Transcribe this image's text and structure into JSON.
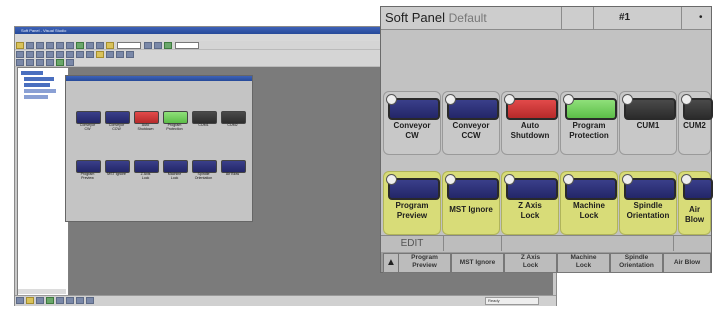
{
  "ide": {
    "title": "Soft Panel - Visual Studio",
    "menu": [
      "File",
      "Edit",
      "View",
      "Project",
      "Build",
      "Debug",
      "Tools",
      "Window",
      "Help"
    ],
    "status_text": "Ready"
  },
  "inner_panel": {
    "row1": [
      {
        "label": "Conveyor\nCW",
        "color": "blue"
      },
      {
        "label": "Conveyor\nCCW",
        "color": "blue"
      },
      {
        "label": "Auto\nShutdown",
        "color": "red"
      },
      {
        "label": "Program\nProtection",
        "color": "green"
      },
      {
        "label": "CUM1",
        "color": "dark"
      },
      {
        "label": "CUM2",
        "color": "dark"
      }
    ],
    "row2": [
      {
        "label": "Program\nPreview",
        "color": "blue"
      },
      {
        "label": "MST Ignore",
        "color": "blue"
      },
      {
        "label": "Z Axis\nLock",
        "color": "blue"
      },
      {
        "label": "Machine\nLock",
        "color": "blue"
      },
      {
        "label": "Spindle\nOrientation",
        "color": "blue"
      },
      {
        "label": "Air Blow",
        "color": "blue"
      }
    ]
  },
  "soft_panel": {
    "title": "Soft Panel",
    "subtitle": "Default",
    "number": "#1",
    "row1": [
      {
        "label": "Conveyor\nCW",
        "color": "blue"
      },
      {
        "label": "Conveyor\nCCW",
        "color": "blue"
      },
      {
        "label": "Auto\nShutdown",
        "color": "red"
      },
      {
        "label": "Program\nProtection",
        "color": "green"
      },
      {
        "label": "CUM1",
        "color": "dark"
      },
      {
        "label": "CUM2",
        "color": "dark"
      }
    ],
    "row2": [
      {
        "label": "Program\nPreview",
        "color": "blue"
      },
      {
        "label": "MST Ignore",
        "color": "blue"
      },
      {
        "label": "Z Axis\nLock",
        "color": "blue"
      },
      {
        "label": "Machine\nLock",
        "color": "blue"
      },
      {
        "label": "Spindle\nOrientation",
        "color": "blue"
      },
      {
        "label": "Air Blow",
        "color": "blue"
      }
    ],
    "mode": "EDIT",
    "softkeys": [
      "Program\nPreview",
      "MST Ignore",
      "Z Axis\nLock",
      "Machine\nLock",
      "Spindle\nOrientation",
      "Air Blow"
    ]
  },
  "colors": {
    "blue": "#2f3378",
    "red": "#d13a3a",
    "green": "#7ad266",
    "dark": "#3a3a3a",
    "highlight": "#d8dc78"
  }
}
